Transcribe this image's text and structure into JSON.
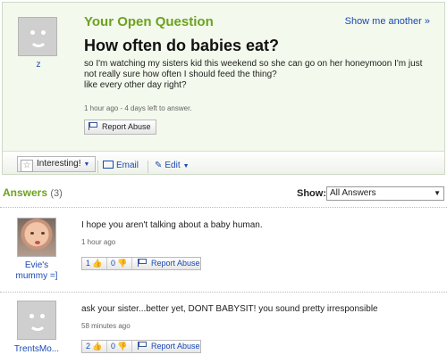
{
  "question": {
    "heading": "Your Open Question",
    "show_another": "Show me another »",
    "asker": "z",
    "title": "How often do babies eat?",
    "body": "so I'm watching my sisters kid this weekend so she can go on her honeymoon I'm just not really sure how often I should feed the thing?\nlike every other day right?",
    "meta": "1 hour ago - 4 days left to answer.",
    "report_label": "Report Abuse"
  },
  "actions": {
    "interesting_label": "Interesting!",
    "email_label": "Email",
    "edit_label": "Edit"
  },
  "answers_header": {
    "title": "Answers",
    "count": "(3)",
    "show_label": "Show:",
    "show_selected": "All Answers"
  },
  "answers": [
    {
      "user": "Evie's mummy =]",
      "text": "I hope you aren't talking about a baby human.",
      "time": "1 hour ago",
      "thumbs_up": "1",
      "thumbs_down": "0",
      "report_label": "Report Abuse"
    },
    {
      "user": "TrentsMo...",
      "text": "ask your sister...better yet, DONT BABYSIT! you sound pretty irresponsible",
      "time": "58 minutes ago",
      "thumbs_up": "2",
      "thumbs_down": "0",
      "report_label": "Report Abuse"
    }
  ],
  "icons": {
    "avatar_default": "smiley-avatar-icon",
    "star": "star-icon",
    "email": "envelope-icon",
    "edit": "pencil-icon",
    "report": "flag-icon",
    "thumbs_up": "thumbs-up-icon",
    "thumbs_down": "thumbs-down-icon"
  },
  "colors": {
    "heading_green": "#6da21f",
    "link_blue": "#1a49b4",
    "question_bg": "#f3f9ec"
  }
}
